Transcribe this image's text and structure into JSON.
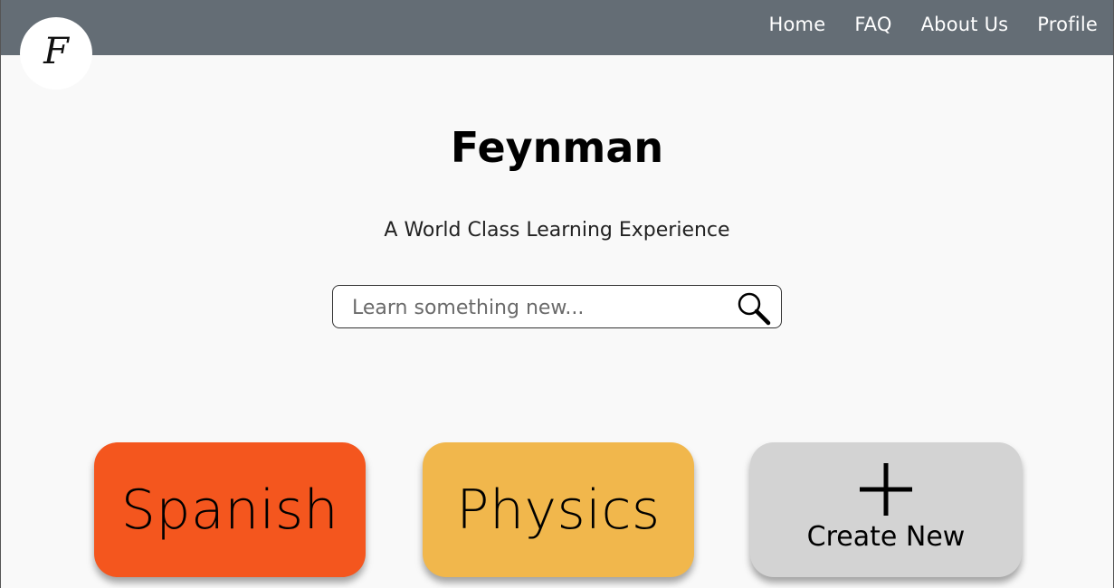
{
  "header": {
    "logo_letter": "F",
    "nav": [
      {
        "label": "Home"
      },
      {
        "label": "FAQ"
      },
      {
        "label": "About Us"
      },
      {
        "label": "Profile"
      }
    ]
  },
  "hero": {
    "title": "Feynman",
    "subtitle": "A World Class Learning Experience"
  },
  "search": {
    "placeholder": "Learn something new...",
    "value": "",
    "icon": "search-icon"
  },
  "cards": [
    {
      "label": "Spanish",
      "color": "#f4561e"
    },
    {
      "label": "Physics",
      "color": "#f1b74c"
    },
    {
      "label": "Create New",
      "color": "#d3d3d3",
      "icon": "plus-icon"
    }
  ],
  "colors": {
    "header_bg": "#646d75",
    "page_bg": "#f9f9f9"
  }
}
